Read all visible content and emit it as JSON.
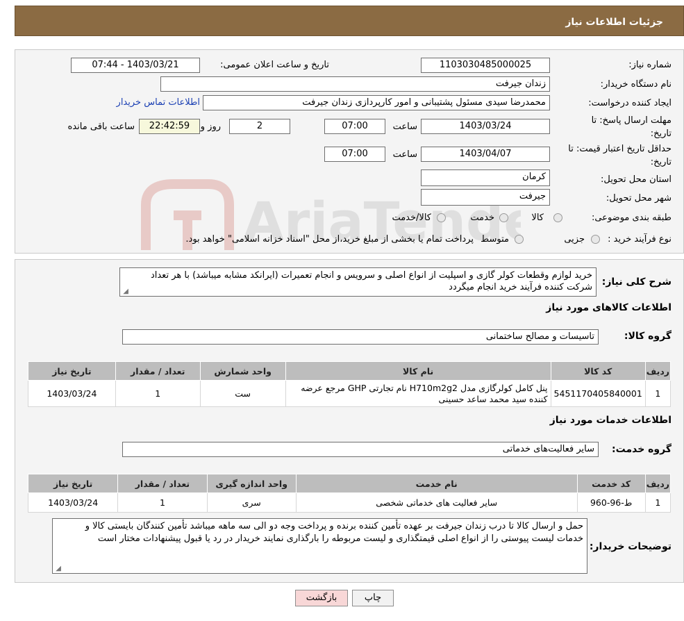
{
  "header": {
    "title": "جزئیات اطلاعات نیاز"
  },
  "form": {
    "need_number_label": "شماره نیاز:",
    "need_number": "1103030485000025",
    "announce_label": "تاریخ و ساعت اعلان عمومی:",
    "announce_value": "1403/03/21 - 07:44",
    "buyer_org_label": "نام دستگاه خریدار:",
    "buyer_org": "زندان جیرفت",
    "creator_label": "ایجاد کننده درخواست:",
    "creator": "محمدرضا سیدی مسئول پشتیبانی و امور کارپردازی زندان جیرفت",
    "contact_link": "اطلاعات تماس خریدار",
    "deadline_label": "مهلت ارسال پاسخ: تا تاریخ:",
    "deadline_date": "1403/03/24",
    "time_label": "ساعت",
    "deadline_time": "07:00",
    "days_value": "2",
    "days_label": "روز و",
    "remaining_time": "22:42:59",
    "remaining_label": "ساعت باقی مانده",
    "validity_label": "حداقل تاریخ اعتبار قیمت: تا تاریخ:",
    "validity_date": "1403/04/07",
    "validity_time": "07:00",
    "province_label": "استان محل تحویل:",
    "province": "کرمان",
    "city_label": "شهر محل تحویل:",
    "city": "جیرفت",
    "category_label": "طبقه بندی موضوعی:",
    "category_options": [
      "کالا",
      "خدمت",
      "کالا/خدمت"
    ],
    "process_label": "نوع فرآیند خرید :",
    "process_options": [
      "جزیی",
      "متوسط"
    ],
    "process_note": "پرداخت تمام یا بخشی از مبلغ خرید،از محل \"اسناد خزانه اسلامی\" خواهد بود."
  },
  "description": {
    "label": "شرح کلی نیاز:",
    "text": "خرید لوازم وقطعات کولر گازی و اسپلیت از انواع اصلی و سرویس و انجام تعمیرات (ایرانکد  مشابه میباشد)  با هر تعداد شرکت کننده فرآیند خرید انجام میگردد"
  },
  "goods": {
    "section_title": "اطلاعات کالاهای مورد نیاز",
    "group_label": "گروه کالا:",
    "group_value": "تاسیسات و مصالح ساختمانی",
    "headers": [
      "ردیف",
      "کد کالا",
      "نام کالا",
      "واحد شمارش",
      "تعداد / مقدار",
      "تاریخ نیاز"
    ],
    "rows": [
      {
        "row": "1",
        "code": "5451170405840001",
        "name": "پنل کامل کولرگازی مدل H710m2g2 نام تجارتی GHP مرجع عرضه کننده سید محمد ساعد حسینی",
        "unit": "ست",
        "qty": "1",
        "date": "1403/03/24"
      }
    ]
  },
  "services": {
    "section_title": "اطلاعات خدمات مورد نیاز",
    "group_label": "گروه خدمت:",
    "group_value": "سایر فعالیت‌های خدماتی",
    "headers": [
      "ردیف",
      "کد خدمت",
      "نام خدمت",
      "واحد اندازه گیری",
      "تعداد / مقدار",
      "تاریخ نیاز"
    ],
    "rows": [
      {
        "row": "1",
        "code": "ط-96-960",
        "name": "سایر فعالیت های خدماتی شخصی",
        "unit": "سری",
        "qty": "1",
        "date": "1403/03/24"
      }
    ]
  },
  "buyer_notes": {
    "label": "توضیحات خریدار:",
    "text": "حمل و ارسال کالا تا درب زندان جیرفت بر عهده تأمین کننده برنده و پرداخت وجه دو الی سه ماهه میباشد تأمین کنندگان بایستی کالا و خدمات لیست پیوستی را از انواع اصلی قیمتگذاری و لیست مربوطه را بارگذاری نمایند خریدار در رد یا قبول پیشنهادات مختار است"
  },
  "buttons": {
    "print": "چاپ",
    "back": "بازگشت"
  },
  "watermark": {
    "text": "AriaTender.neT"
  },
  "colors": {
    "header": "#8b6b43",
    "table_header": "#bdbdbd",
    "link": "#1a3fb3",
    "back_button": "#f8d7d7"
  }
}
